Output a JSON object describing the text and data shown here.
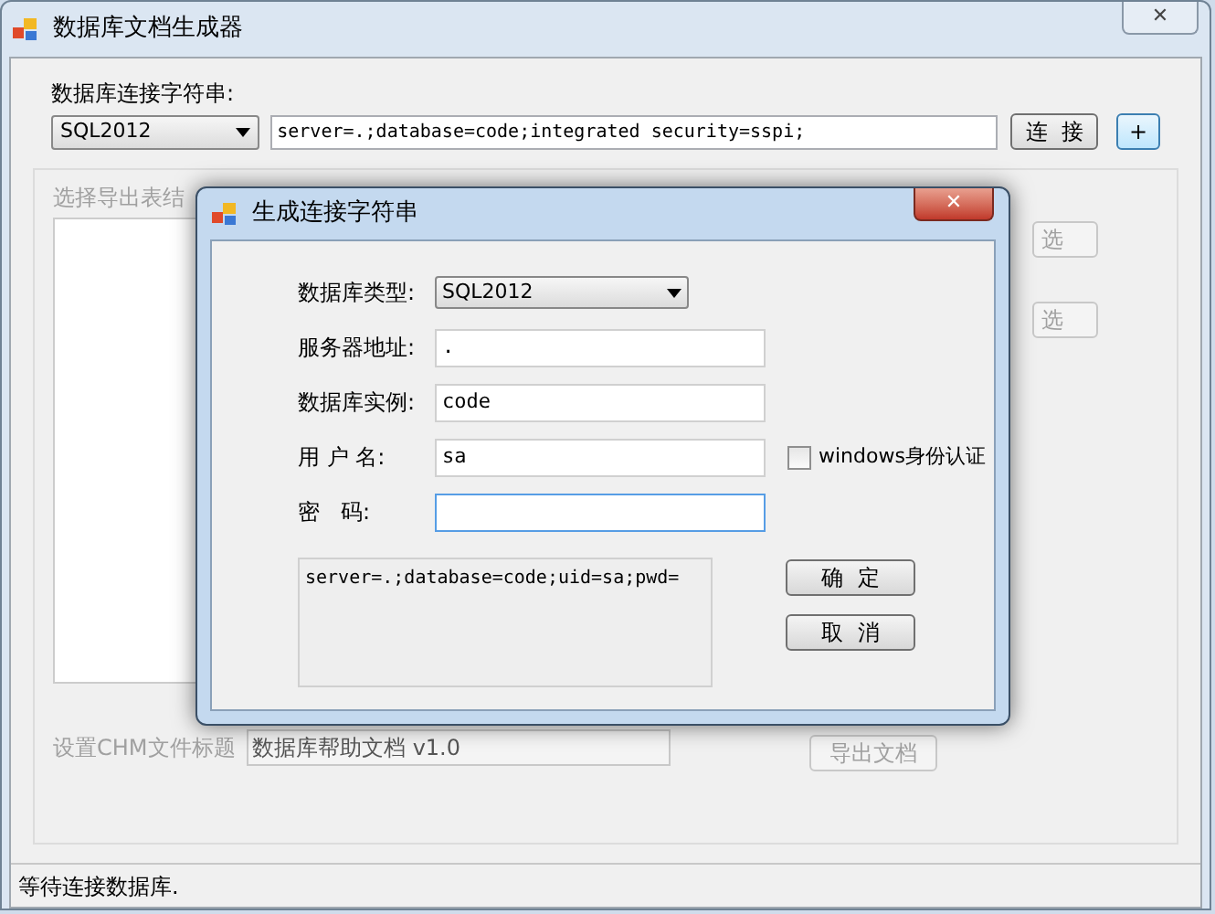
{
  "window": {
    "title": "数据库文档生成器",
    "close": "✕"
  },
  "connection": {
    "label": "数据库连接字符串:",
    "db_type": "SQL2012",
    "value": "server=.;database=code;integrated security=sspi;",
    "connect_button": "连  接",
    "add_button": "+"
  },
  "export_group": {
    "disabled": true,
    "label": "选择导出表结",
    "select_buttons": [
      "选",
      "选"
    ],
    "chm_title_label": "设置CHM文件标题",
    "chm_title_value": "数据库帮助文档 v1.0",
    "export_button": "导出文档"
  },
  "status_bar": {
    "text": "等待连接数据库."
  },
  "dialog": {
    "title": "生成连接字符串",
    "close": "✕",
    "fields": [
      {
        "kind": "select",
        "label": "数据库类型:",
        "value": "SQL2012"
      },
      {
        "kind": "text",
        "label": "服务器地址:",
        "value": ".",
        "focused": false
      },
      {
        "kind": "text",
        "label": "数据库实例:",
        "value": "code",
        "focused": false
      },
      {
        "kind": "text",
        "label": "用 户 名:",
        "value": "sa",
        "focused": false
      },
      {
        "kind": "text",
        "label": "密   码:",
        "focused": true
      }
    ],
    "windows_auth": {
      "label": "windows身份认证",
      "checked": false
    },
    "result": "server=.;database=code;uid=sa;pwd=",
    "ok_button": "确  定",
    "cancel_button": "取  消"
  }
}
